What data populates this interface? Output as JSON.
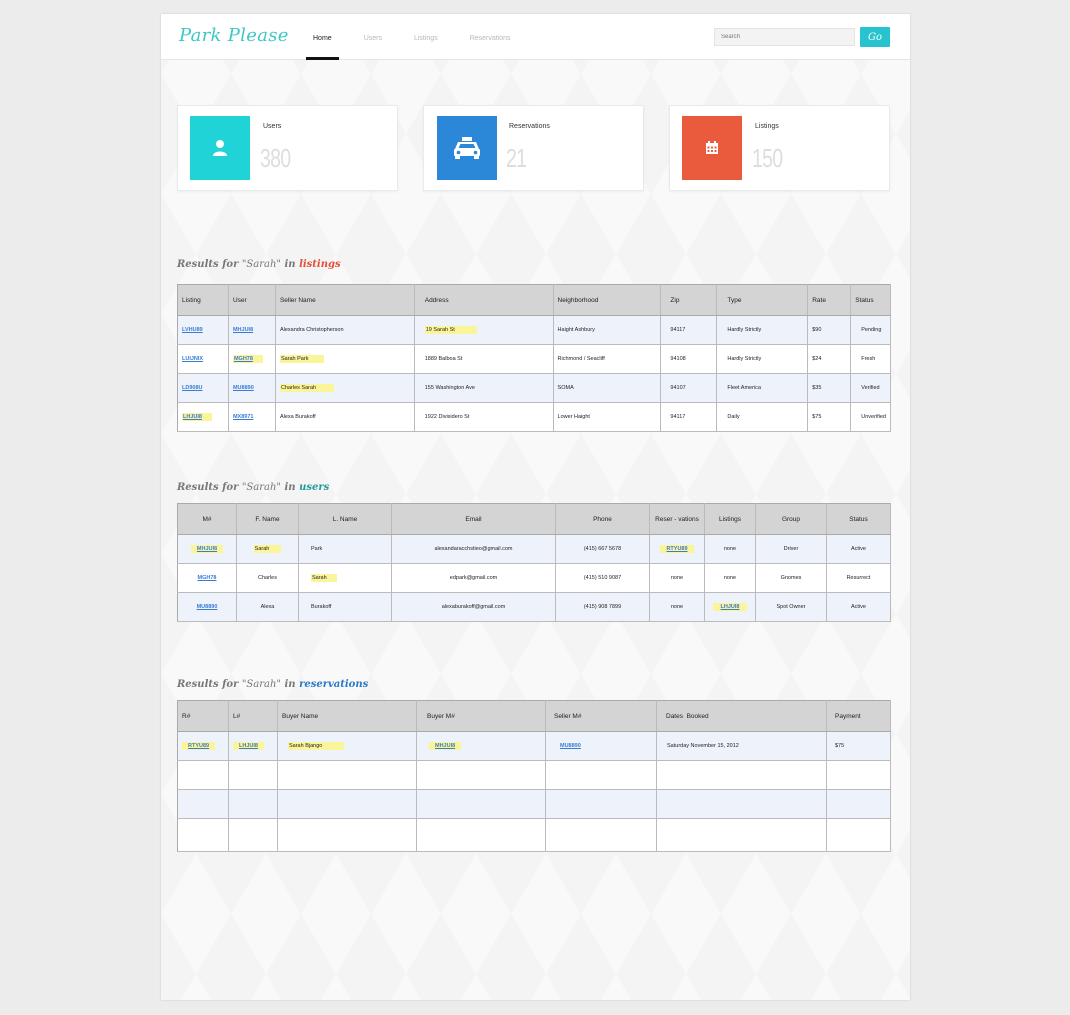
{
  "app": {
    "logo": "Park Please"
  },
  "nav": {
    "items": [
      "Home",
      "Users",
      "Listings",
      "Reservations"
    ],
    "active": "Home"
  },
  "search": {
    "placeholder": "Search",
    "button": "Go"
  },
  "stats": [
    {
      "label": "Users",
      "value": "380",
      "color": "#1fd3d6",
      "icon": "user-icon"
    },
    {
      "label": "Reservations",
      "value": "21",
      "color": "#2b88d8",
      "icon": "taxi-icon"
    },
    {
      "label": "Listings",
      "value": "150",
      "color": "#ea5b3e",
      "icon": "calendar-icon"
    }
  ],
  "sections": {
    "listings": {
      "prefix": "Results for ",
      "query": "\"Sarah\"",
      "mid": " in ",
      "category": "listings",
      "color": "#e2503a"
    },
    "users": {
      "prefix": "Results for ",
      "query": "\"Sarah\"",
      "mid": " in ",
      "category": "users",
      "color": "#239a9a"
    },
    "reservations": {
      "prefix": "Results for ",
      "query": "\"Sarah\"",
      "mid": " in ",
      "category": "reservations",
      "color": "#2b78c6"
    }
  },
  "listings_table": {
    "headers": [
      "Listing",
      "User",
      "Seller Name",
      "Address",
      "Neighborhood",
      "Zip",
      "Type",
      "Rate",
      "Status"
    ],
    "rows": [
      [
        "LVHU89",
        "MHJUI8",
        "Alexandra Christopherson",
        "19 Sarah St",
        "Haight Ashbury",
        "94117",
        "Hardly Strictly",
        "$90",
        "Pending"
      ],
      [
        "LUIJNIX",
        "MGH78",
        "Sarah Park",
        "1889 Balboa St",
        "Richmond / Seacliff",
        "94108",
        "Hardly Strictly",
        "$24",
        "Fresh"
      ],
      [
        "LD908U",
        "MU8890",
        "Charles Sarah",
        "155 Washington Ave",
        "SOMA",
        "94107",
        "Fleet America",
        "$35",
        "Verified"
      ],
      [
        "LHJUI8",
        "MX8971",
        "Alexa Burakoff",
        "1922 Divisidero St",
        "Lower Haight",
        "94117",
        "Daily",
        "$75",
        "Unverified"
      ]
    ]
  },
  "users_table": {
    "headers": [
      "M#",
      "F. Name",
      "L. Name",
      "Email",
      "Phone",
      "Reser - vations",
      "Listings",
      "Group",
      "Status"
    ],
    "rows": [
      [
        "MHJUI8",
        "Sarah",
        "Park",
        "alexandaracchstieo@gmail.com",
        "(415) 667 5678",
        "RTYU89",
        "none",
        "Driver",
        "Active"
      ],
      [
        "MGH78",
        "Charles",
        "Sarah",
        "edpark@gmail.com",
        "(415) 510 9087",
        "none",
        "none",
        "Gnomes",
        "Resurrect"
      ],
      [
        "MU8890",
        "Alexa",
        "Burakoff",
        "alexaburakoff@gmail.com",
        "(415) 908 7899",
        "none",
        "LHJUI8",
        "Spot Owner",
        "Active"
      ]
    ]
  },
  "reservations_table": {
    "headers": [
      "R#",
      "L#",
      "Buyer Name",
      "Buyer M#",
      "Seller M#",
      "Dates  Booked",
      "Payment"
    ],
    "rows": [
      [
        "RTYU89",
        "LHJUI8",
        "Sarah Bjango",
        "MHJUI8",
        "MU8890",
        "Saturday November 15, 2012",
        "$75"
      ],
      [
        "",
        "",
        "",
        "",
        "",
        "",
        ""
      ],
      [
        "",
        "",
        "",
        "",
        "",
        "",
        ""
      ],
      [
        "",
        "",
        "",
        "",
        "",
        "",
        ""
      ]
    ]
  }
}
